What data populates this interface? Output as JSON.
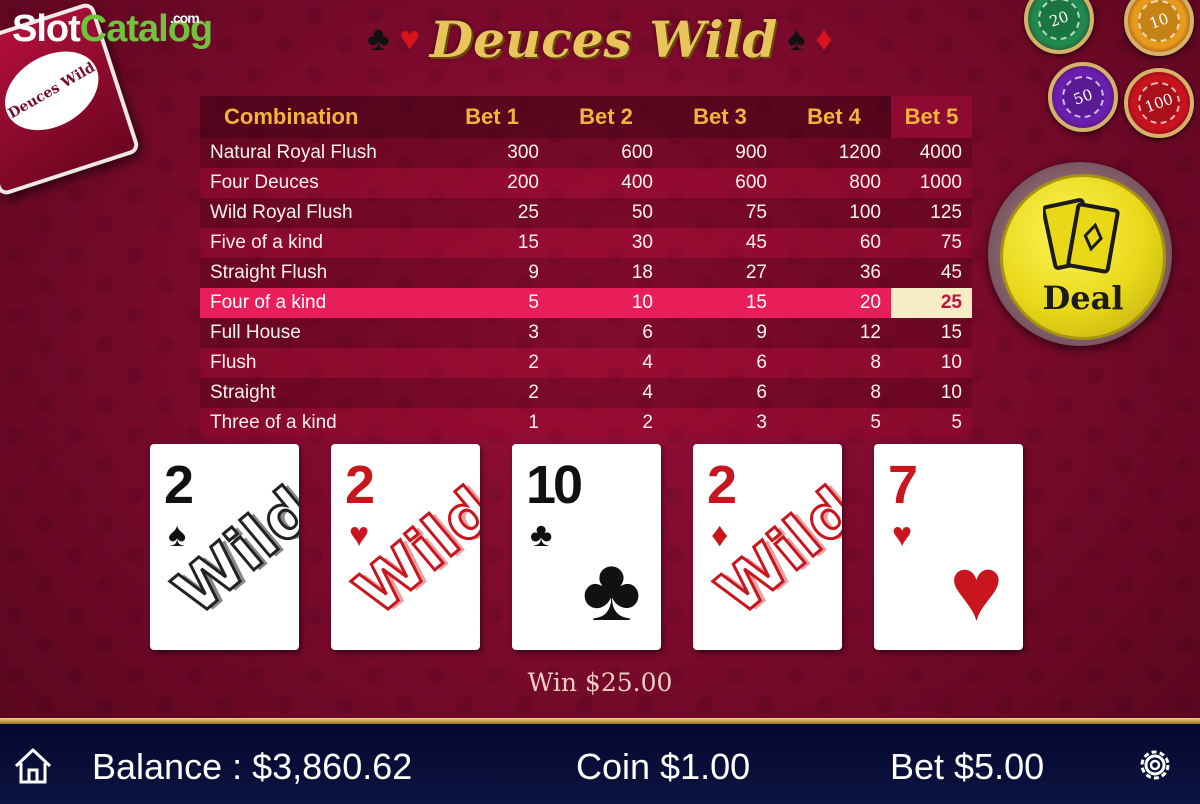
{
  "watermark": {
    "part1": "Slot",
    "part2": "Catalog",
    "suffix": ".com"
  },
  "deck_logo": "Deuces Wild",
  "title": {
    "text": "Deuces Wild",
    "suits_left": [
      "♣",
      "♥"
    ],
    "suits_right": [
      "♠",
      "♦"
    ]
  },
  "chips": [
    {
      "value": "20",
      "color": "#1f8a4c"
    },
    {
      "value": "10",
      "color": "#e89a1a"
    },
    {
      "value": "50",
      "color": "#6a1fb0"
    },
    {
      "value": "100",
      "color": "#c8131e"
    }
  ],
  "paytable": {
    "headers": [
      "Combination",
      "Bet 1",
      "Bet 2",
      "Bet 3",
      "Bet 4",
      "Bet 5"
    ],
    "rows": [
      [
        "Natural Royal Flush",
        "300",
        "600",
        "900",
        "1200",
        "4000"
      ],
      [
        "Four Deuces",
        "200",
        "400",
        "600",
        "800",
        "1000"
      ],
      [
        "Wild Royal Flush",
        "25",
        "50",
        "75",
        "100",
        "125"
      ],
      [
        "Five of a kind",
        "15",
        "30",
        "45",
        "60",
        "75"
      ],
      [
        "Straight Flush",
        "9",
        "18",
        "27",
        "36",
        "45"
      ],
      [
        "Four of a kind",
        "5",
        "10",
        "15",
        "20",
        "25"
      ],
      [
        "Full House",
        "3",
        "6",
        "9",
        "12",
        "15"
      ],
      [
        "Flush",
        "2",
        "4",
        "6",
        "8",
        "10"
      ],
      [
        "Straight",
        "2",
        "4",
        "6",
        "8",
        "10"
      ],
      [
        "Three of a kind",
        "1",
        "2",
        "3",
        "5",
        "5"
      ]
    ]
  },
  "deal_button": {
    "label": "Deal"
  },
  "cards": [
    {
      "rank": "2",
      "suit": "♠",
      "color": "black",
      "wild": "Wild"
    },
    {
      "rank": "2",
      "suit": "♥",
      "color": "red",
      "wild": "Wild"
    },
    {
      "rank": "10",
      "suit": "♣",
      "color": "black",
      "wild": ""
    },
    {
      "rank": "2",
      "suit": "♦",
      "color": "red",
      "wild": "Wild"
    },
    {
      "rank": "7",
      "suit": "♥",
      "color": "red",
      "wild": ""
    }
  ],
  "win_text": "Win $25.00",
  "bottom_bar": {
    "balance": "Balance : $3,860.62",
    "coin": "Coin $1.00",
    "bet": "Bet $5.00"
  }
}
